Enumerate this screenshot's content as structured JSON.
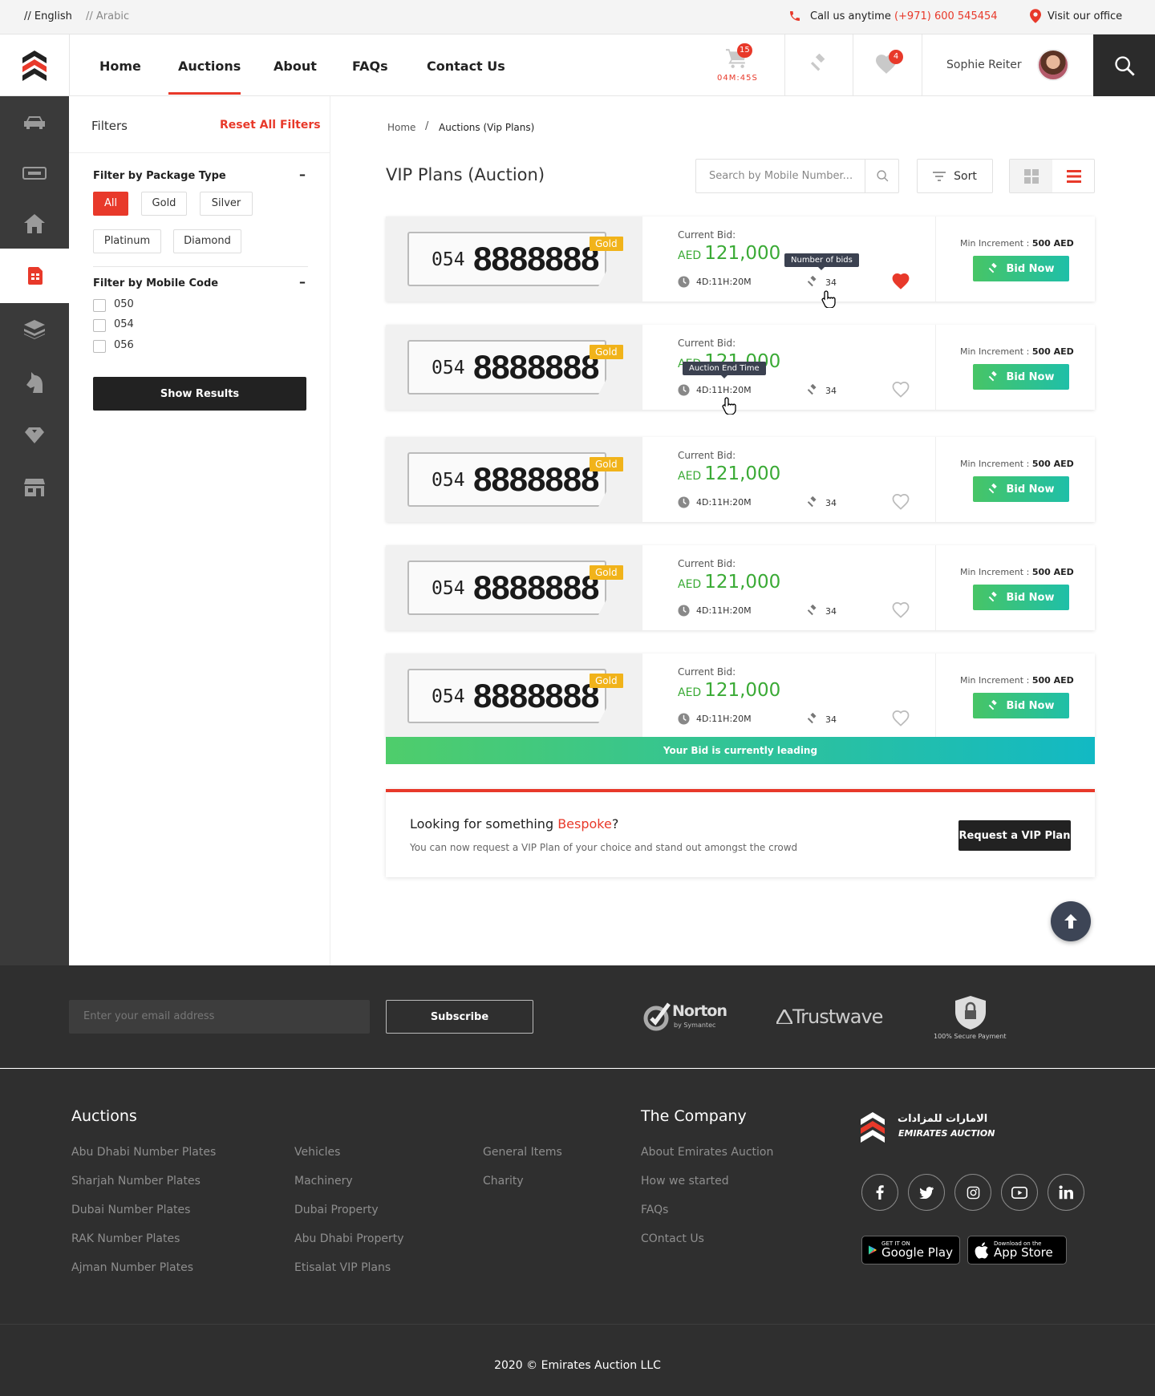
{
  "topbar": {
    "lang_en": "// English",
    "lang_ar": "// Arabic",
    "call_label": "Call us anytime",
    "phone": "(+971) 600 545454",
    "office": "Visit our office"
  },
  "nav": {
    "items": [
      "Home",
      "Auctions",
      "About",
      "FAQs",
      "Contact Us"
    ],
    "active": "Auctions",
    "cart_count": "15",
    "cart_timer": "04M:45S",
    "wishlist_count": "4",
    "user_name": "Sophie Reiter"
  },
  "sidebar": {
    "icons": [
      "car-icon",
      "plate-icon",
      "home-icon",
      "sim-card-icon",
      "layers-icon",
      "horse-icon",
      "diamond-icon",
      "store-icon"
    ],
    "active": "sim-card-icon"
  },
  "filters": {
    "title": "Filters",
    "reset": "Reset All Filters",
    "package_title": "Filter by Package Type",
    "packages": [
      "All",
      "Gold",
      "Silver",
      "Platinum",
      "Diamond"
    ],
    "active_package": "All",
    "code_title": "Filter by Mobile Code",
    "codes": [
      "050",
      "054",
      "056"
    ],
    "show_results": "Show Results"
  },
  "main": {
    "breadcrumb_home": "Home",
    "breadcrumb_sep": "/",
    "breadcrumb_current": "Auctions (Vip Plans)",
    "title": "VIP Plans (Auction)",
    "search_placeholder": "Search by Mobile Number...",
    "sort_label": "Sort",
    "view_mode": "list"
  },
  "listings": [
    {
      "code": "054",
      "number": "8888888",
      "tier": "Gold",
      "bid_label": "Current Bid:",
      "currency": "AED",
      "bid": "121,000",
      "timer": "4D:11H:20M",
      "bids": "34",
      "favorited": true,
      "min_increment_label": "Min Increment :",
      "min_increment": "500 AED",
      "button": "Bid Now"
    },
    {
      "code": "054",
      "number": "8888888",
      "tier": "Gold",
      "bid_label": "Current Bid:",
      "currency": "AED",
      "bid": "121,000",
      "timer": "4D:11H:20M",
      "bids": "34",
      "favorited": false,
      "min_increment_label": "Min Increment :",
      "min_increment": "500 AED",
      "button": "Bid Now"
    },
    {
      "code": "054",
      "number": "8888888",
      "tier": "Gold",
      "bid_label": "Current Bid:",
      "currency": "AED",
      "bid": "121,000",
      "timer": "4D:11H:20M",
      "bids": "34",
      "favorited": false,
      "min_increment_label": "Min Increment :",
      "min_increment": "500 AED",
      "button": "Bid Now"
    },
    {
      "code": "054",
      "number": "8888888",
      "tier": "Gold",
      "bid_label": "Current Bid:",
      "currency": "AED",
      "bid": "121,000",
      "timer": "4D:11H:20M",
      "bids": "34",
      "favorited": false,
      "min_increment_label": "Min Increment :",
      "min_increment": "500 AED",
      "button": "Bid Now"
    },
    {
      "code": "054",
      "number": "8888888",
      "tier": "Gold",
      "bid_label": "Current Bid:",
      "currency": "AED",
      "bid": "121,000",
      "timer": "4D:11H:20M",
      "bids": "34",
      "favorited": false,
      "min_increment_label": "Min Increment :",
      "min_increment": "500 AED",
      "button": "Bid Now"
    }
  ],
  "tooltips": {
    "bids": "Number of bids",
    "end_time": "Auction End Time"
  },
  "leading_banner": "Your Bid is currently leading",
  "bespoke": {
    "title_prefix": "Looking for something ",
    "title_highlight": "Bespoke",
    "title_suffix": "?",
    "subtitle": "You can now request a VIP Plan of your choice and stand out amongst the crowd",
    "button": "Request a VIP Plan"
  },
  "footer": {
    "email_placeholder": "Enter your email address",
    "subscribe": "Subscribe",
    "badges": {
      "norton": "Norton",
      "norton_sub": "by Symantec",
      "trustwave": "Trustwave",
      "secure": "100% Secure Payment"
    },
    "auctions_title": "Auctions",
    "auctions_col1": [
      "Abu Dhabi Number Plates",
      "Sharjah Number Plates",
      "Dubai Number Plates",
      "RAK Number Plates",
      "Ajman Number Plates"
    ],
    "auctions_col2": [
      "Vehicles",
      "Machinery",
      "Dubai Property",
      "Abu Dhabi Property",
      "Etisalat VIP Plans"
    ],
    "auctions_col3": [
      "General Items",
      "Charity"
    ],
    "company_title": "The Company",
    "company_links": [
      "About Emirates Auction",
      "How we started",
      "FAQs",
      "COntact Us"
    ],
    "brand_en": "EMIRATES AUCTION",
    "brand_ar": "الامارات للمزادات",
    "socials": [
      "facebook-icon",
      "twitter-icon",
      "instagram-icon",
      "youtube-icon",
      "linkedin-icon"
    ],
    "google_small": "GET IT ON",
    "google_big": "Google Play",
    "apple_small": "Download on the",
    "apple_big": "App Store",
    "copyright": "2020 © Emirates Auction LLC"
  },
  "colors": {
    "accent": "#e8392a",
    "green": "#3aaa35",
    "gold": "#f1b31a",
    "dark": "#2f2f2f"
  }
}
